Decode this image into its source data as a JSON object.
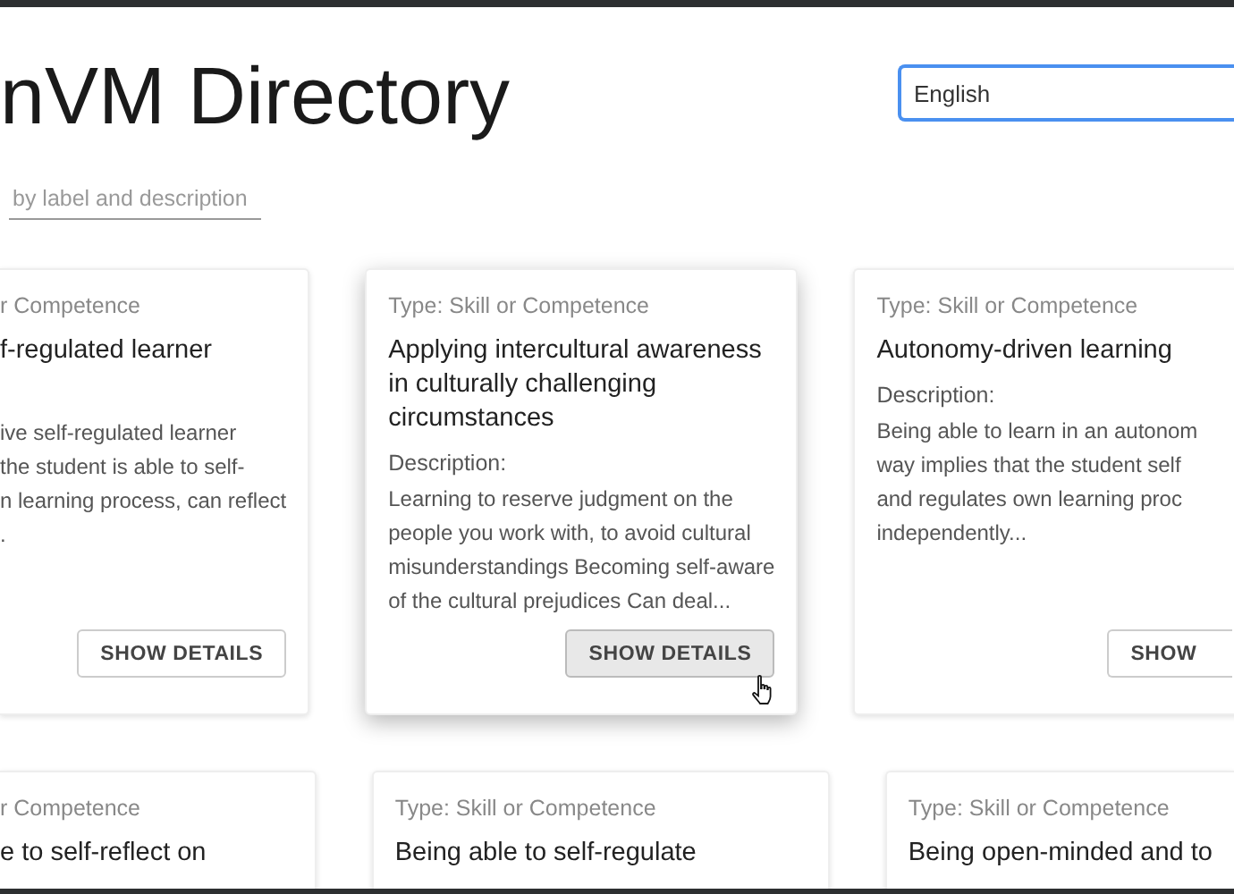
{
  "header": {
    "title": "nVM Directory",
    "language": "English",
    "search": {
      "placeholder": "by label and description"
    }
  },
  "card_rows": [
    {
      "cards": [
        {
          "kind": "cut_left",
          "hovered": false,
          "type": "r Competence",
          "title_lines": [
            "f-regulated learner"
          ],
          "description_lines": [
            "ive self-regulated learner",
            "the student is able to self-",
            "n learning process, can reflect",
            "."
          ],
          "button": "SHOW DETAILS"
        },
        {
          "kind": "whole",
          "hovered": true,
          "type": "Type: Skill or Competence",
          "title_lines": [
            "Applying intercultural awareness",
            "in culturally challenging",
            "circumstances"
          ],
          "description_label": "Description:",
          "description_lines": [
            "Learning to reserve judgment on the",
            "people you work with, to avoid cultural",
            "misunderstandings Becoming self-aware",
            "of the cultural prejudices Can deal..."
          ],
          "button": "SHOW DETAILS"
        },
        {
          "kind": "cut_right",
          "hovered": false,
          "type": "Type: Skill or Competence",
          "title_lines": [
            "Autonomy-driven learning"
          ],
          "description_label": "Description:",
          "description_lines": [
            "Being able to learn in an autonom",
            "way implies that the student self",
            "and regulates own learning proc",
            "independently..."
          ],
          "button": "SHOW"
        }
      ]
    },
    {
      "cards": [
        {
          "kind": "cut_left",
          "hovered": false,
          "type": "r Competence",
          "title_lines": [
            "e to self-reflect on"
          ]
        },
        {
          "kind": "whole",
          "hovered": false,
          "type": "Type: Skill or Competence",
          "title_lines": [
            "Being able to self-regulate"
          ]
        },
        {
          "kind": "cut_right",
          "hovered": false,
          "type": "Type: Skill or Competence",
          "title_lines": [
            "Being open-minded and to"
          ]
        }
      ]
    }
  ]
}
